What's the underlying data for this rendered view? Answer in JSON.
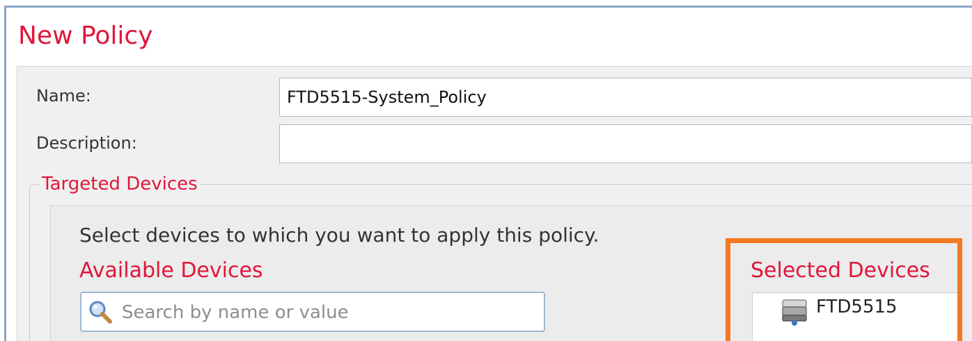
{
  "dialog": {
    "title": "New Policy"
  },
  "form": {
    "name": {
      "label": "Name:",
      "value": "FTD5515-System_Policy"
    },
    "description": {
      "label": "Description:",
      "value": ""
    }
  },
  "targeted_devices": {
    "legend": "Targeted Devices",
    "instruction": "Select devices to which you want to apply this policy.",
    "available": {
      "title": "Available Devices",
      "search_placeholder": "Search by name or value",
      "search_icon": "magnifier-icon"
    },
    "selected": {
      "title": "Selected Devices",
      "devices": [
        {
          "name": "FTD5515",
          "icon": "device-icon"
        }
      ]
    }
  },
  "colors": {
    "accent_red": "#e1163a",
    "highlight_orange": "#f47920",
    "frame_blue": "#8aa7c6"
  }
}
